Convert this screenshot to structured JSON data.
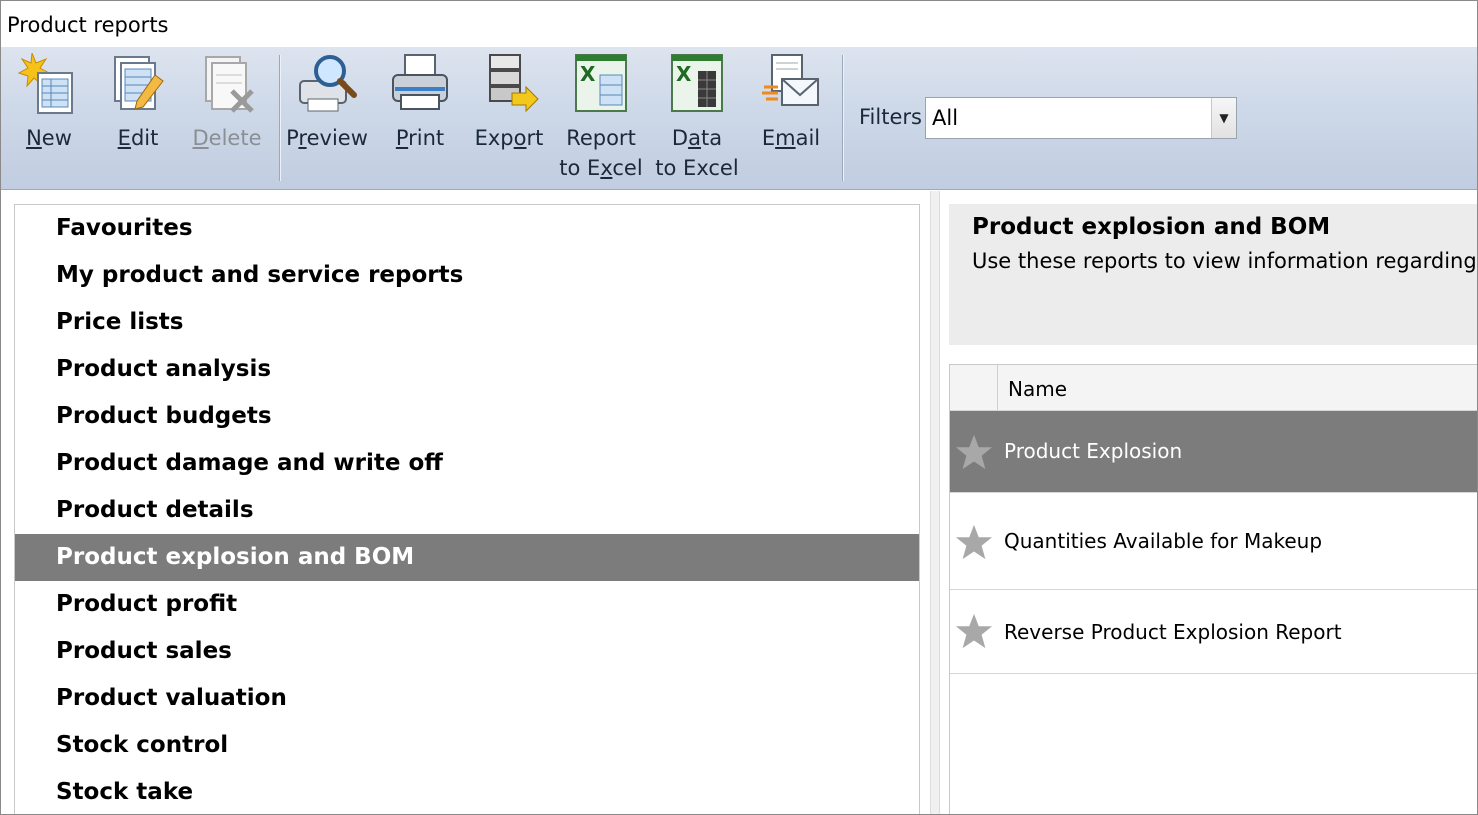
{
  "window": {
    "title": "Product reports"
  },
  "toolbar": {
    "new": {
      "label": "New",
      "hotkey": "N",
      "rest": "ew"
    },
    "edit": {
      "label": "Edit",
      "hotkey": "E",
      "rest": "dit"
    },
    "delete": {
      "label": "Delete",
      "hotkey": "D",
      "rest": "elete"
    },
    "preview": {
      "label": "Preview",
      "pre": "P",
      "hotkey": "r",
      "rest": "eview"
    },
    "print": {
      "label": "Print",
      "hotkey": "P",
      "rest": "rint"
    },
    "export": {
      "label": "Export",
      "pre": "Exp",
      "hotkey": "o",
      "rest": "rt"
    },
    "report_to_excel": {
      "line1": "Report",
      "line2_pre": "to E",
      "hotkey": "x",
      "line2_rest": "cel"
    },
    "data_to_excel": {
      "line1_pre": "D",
      "hotkey": "a",
      "line1_rest": "ta",
      "line2": "to Excel"
    },
    "email": {
      "pre": "E",
      "hotkey": "m",
      "rest": "ail"
    }
  },
  "filters": {
    "label": "Filters",
    "value": "All"
  },
  "categories": [
    {
      "label": "Favourites"
    },
    {
      "label": "My product and service reports"
    },
    {
      "label": "Price lists"
    },
    {
      "label": "Product analysis"
    },
    {
      "label": "Product budgets"
    },
    {
      "label": "Product damage and write off"
    },
    {
      "label": "Product details"
    },
    {
      "label": "Product explosion and BOM",
      "selected": true
    },
    {
      "label": "Product profit"
    },
    {
      "label": "Product sales"
    },
    {
      "label": "Product valuation"
    },
    {
      "label": "Stock control"
    },
    {
      "label": "Stock take"
    }
  ],
  "description": {
    "title": "Product explosion and BOM",
    "text": "Use these reports to view information regarding"
  },
  "grid": {
    "header": {
      "name": "Name"
    },
    "rows": [
      {
        "name": "Product Explosion",
        "favourite": false,
        "selected": true
      },
      {
        "name": "Quantities Available for Makeup",
        "favourite": false,
        "selected": false
      },
      {
        "name": "Reverse Product Explosion Report",
        "favourite": false,
        "selected": false
      }
    ]
  },
  "colors": {
    "selection": "#7c7c7c",
    "toolbar": "#cdd8e8",
    "star": "#a8a8a8"
  }
}
